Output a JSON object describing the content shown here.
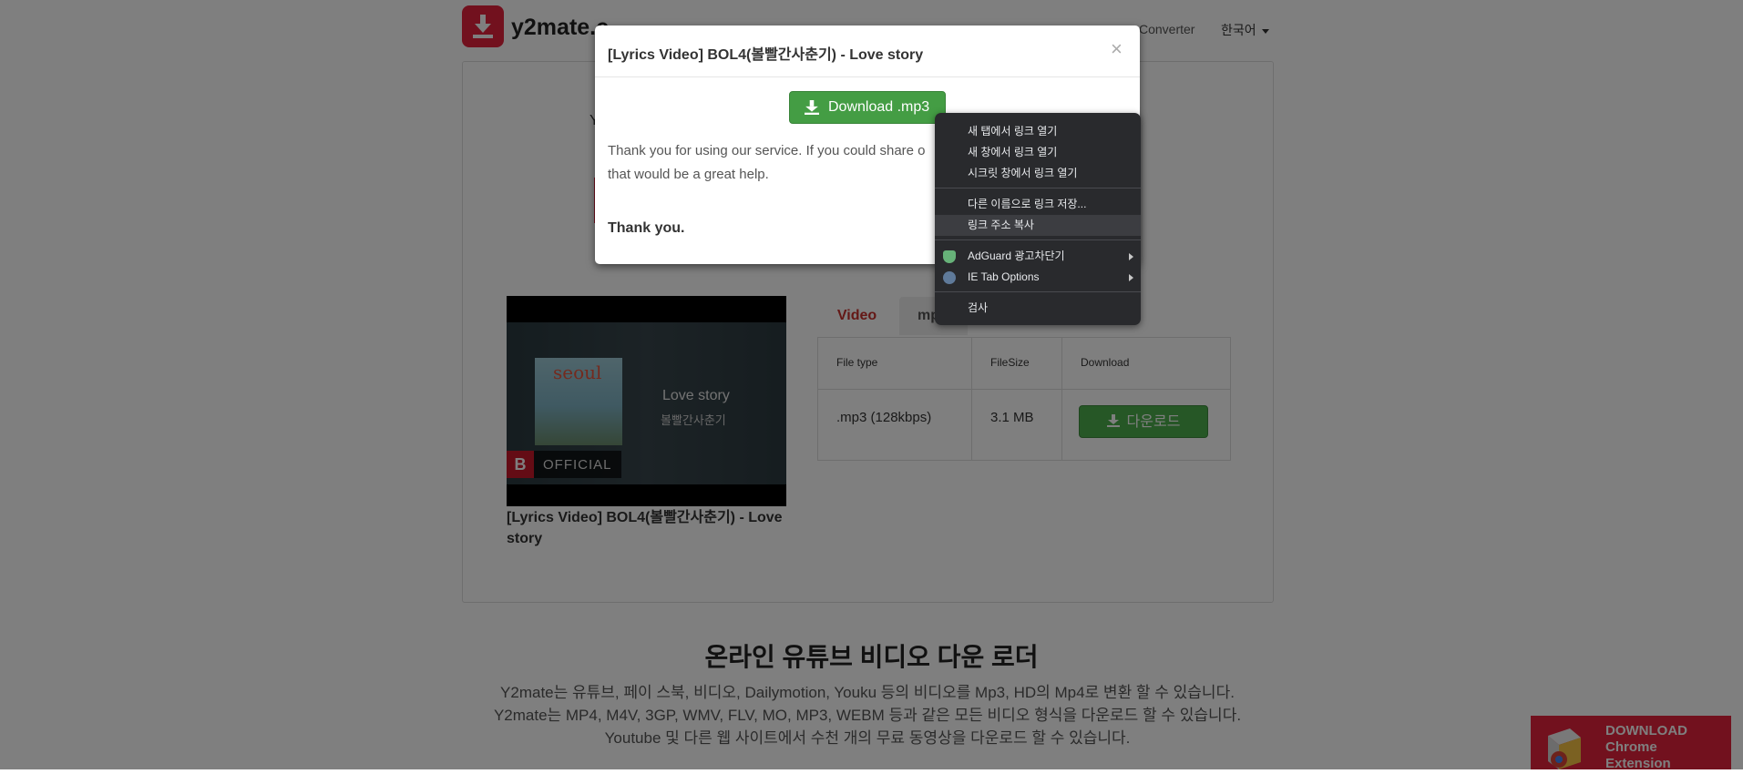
{
  "nav": {
    "brand": "y2mate.c",
    "converter": "Converter",
    "language": "한국어"
  },
  "page": {
    "fragment_y": "Y",
    "tabs": [
      "Video",
      "mp"
    ],
    "table": {
      "headers": [
        "File type",
        "FileSize",
        "Download"
      ],
      "rows": [
        {
          "type": ".mp3 (128kbps)",
          "size": "3.1 MB",
          "action": "다운로드"
        }
      ]
    },
    "video": {
      "thumb_title": "Love story",
      "thumb_subtitle": "볼빨간사춘기",
      "album_text": "seoul",
      "badge_letter": "B",
      "official": "OFFICIAL",
      "caption": "[Lyrics Video] BOL4(볼빨간사춘기) - Love story"
    },
    "section_title": "온라인 유튜브 비디오 다운 로더",
    "section_desc": "Y2mate는 유튜브, 페이 스북, 비디오, Dailymotion, Youku 등의 비디오를 Mp3, HD의 Mp4로 변환 할 수 있습니다. Y2mate는 MP4, M4V, 3GP, WMV, FLV, MO, MP3, WEBM 등과 같은 모든 비디오 형식을 다운로드 할 수 있습니다. Youtube 및 다른 웹 사이트에서 수천 개의 무료 동영상을 다운로드 할 수 있습니다.",
    "chrome_ext": [
      "DOWNLOAD",
      "Chrome",
      "Extension"
    ]
  },
  "modal": {
    "title": "[Lyrics Video] BOL4(볼빨간사춘기) - Love story",
    "close": "×",
    "download_label": "Download .mp3",
    "body_text": "Thank you for using our service. If you could share o that would be a great help.",
    "thanks": "Thank you."
  },
  "context_menu": {
    "items": [
      {
        "label": "새 탭에서 링크 열기"
      },
      {
        "label": "새 창에서 링크 열기"
      },
      {
        "label": "시크릿 창에서 링크 열기"
      },
      {
        "label": "다른 이름으로 링크 저장..."
      },
      {
        "label": "링크 주소 복사",
        "highlighted": true
      },
      {
        "label": "AdGuard 광고차단기",
        "icon": "adguard-shield-icon",
        "submenu": true
      },
      {
        "label": "IE Tab Options",
        "icon": "ie-tab-icon",
        "submenu": true
      },
      {
        "label": "검사"
      }
    ]
  },
  "colors": {
    "brand_red": "#e4233c",
    "download_green": "#449d44",
    "menu_bg": "#292a2d"
  }
}
